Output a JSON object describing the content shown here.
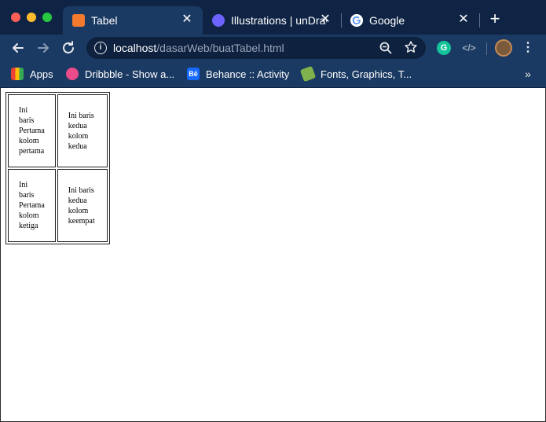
{
  "browser": {
    "tabs": [
      {
        "title": "Tabel",
        "favicon": "xampp-icon",
        "active": true
      },
      {
        "title": "Illustrations | unDraw",
        "favicon": "undraw-icon",
        "active": false
      },
      {
        "title": "Google",
        "favicon": "google-icon",
        "active": false
      }
    ],
    "close_glyph": "✕",
    "new_tab_glyph": "+",
    "address": {
      "host": "localhost",
      "path": "/dasarWeb/buatTabel.html"
    },
    "bookmarks": [
      {
        "label": "Apps",
        "icon": "apps-icon"
      },
      {
        "label": "Dribbble - Show a...",
        "icon": "dribbble-icon"
      },
      {
        "label": "Behance :: Activity",
        "icon": "behance-icon"
      },
      {
        "label": "Fonts, Graphics, T...",
        "icon": "fonts-tag-icon"
      }
    ],
    "behance_icon_text": "Bē",
    "more_bookmarks_glyph": "»"
  },
  "table": {
    "rows": [
      [
        [
          "Ini",
          "baris",
          "Pertama",
          "kolom",
          "pertama"
        ],
        [
          "Ini baris",
          "kedua",
          "kolom",
          "kedua"
        ]
      ],
      [
        [
          "Ini",
          "baris",
          "Pertama",
          "kolom",
          "ketiga"
        ],
        [
          "Ini baris",
          "kedua",
          "kolom",
          "keempat"
        ]
      ]
    ]
  },
  "colors": {
    "titlebar": "#0f2445",
    "toolbar": "#1b3a63",
    "omnibox": "#0e213f"
  }
}
